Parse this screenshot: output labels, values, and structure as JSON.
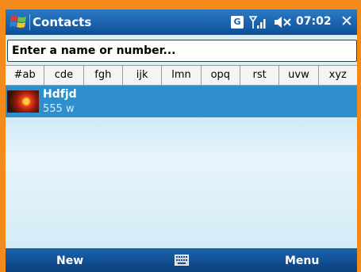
{
  "titlebar": {
    "title": "Contacts",
    "g_badge": "G",
    "clock": "07:02",
    "close_glyph": "✕",
    "icons": [
      "windows-start-icon",
      "signal-icon",
      "volume-muted-icon"
    ]
  },
  "search": {
    "placeholder": "Enter a name or number..."
  },
  "letters": [
    "#ab",
    "cde",
    "fgh",
    "ijk",
    "lmn",
    "opq",
    "rst",
    "uvw",
    "xyz"
  ],
  "contacts": [
    {
      "name": "Hdfjd",
      "detail": "555  w"
    }
  ],
  "menubar": {
    "left": "New",
    "right": "Menu"
  },
  "colors": {
    "accent": "#2f8fcc",
    "titlebar": "#1a5fab",
    "frame": "#f28a1c"
  }
}
